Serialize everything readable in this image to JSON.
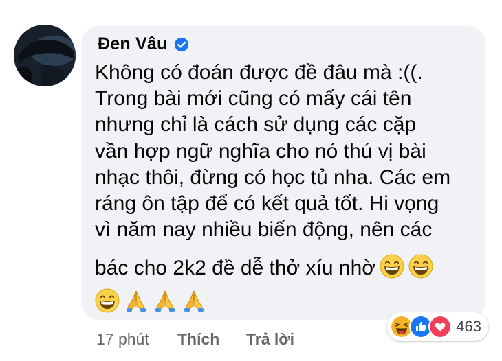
{
  "author": {
    "name": "Đen Vâu",
    "verified": true
  },
  "comment": {
    "lines": [
      "Không có đoán được đề đâu mà :((.",
      "Trong bài mới cũng có mấy cái tên",
      "nhưng chỉ là cách sử dụng các cặp",
      "vần hợp ngữ nghĩa cho nó thú vị bài",
      "nhạc thôi, đừng có học tủ nha. Các em",
      "ráng ôn tập để có kết quả tốt. Hi vọng",
      "vì năm nay nhiều biến động, nên các",
      "bác cho 2k2 đề dễ thở xíu nhờ"
    ],
    "inline_emojis": [
      "grinning-face",
      "grinning-face"
    ],
    "trailing_emojis": [
      "grinning-face",
      "folded-hands",
      "folded-hands",
      "folded-hands"
    ]
  },
  "actions": {
    "time": "17 phút",
    "like": "Thích",
    "reply": "Trả lời"
  },
  "reactions": {
    "types": [
      "haha",
      "like",
      "love"
    ],
    "count": "463"
  },
  "colors": {
    "bubble": "#f0f2f5",
    "verified": "#1877f2",
    "like": "#1877f2",
    "love": "#f33e58",
    "haha": "#f7b125",
    "meta": "#65676b"
  }
}
